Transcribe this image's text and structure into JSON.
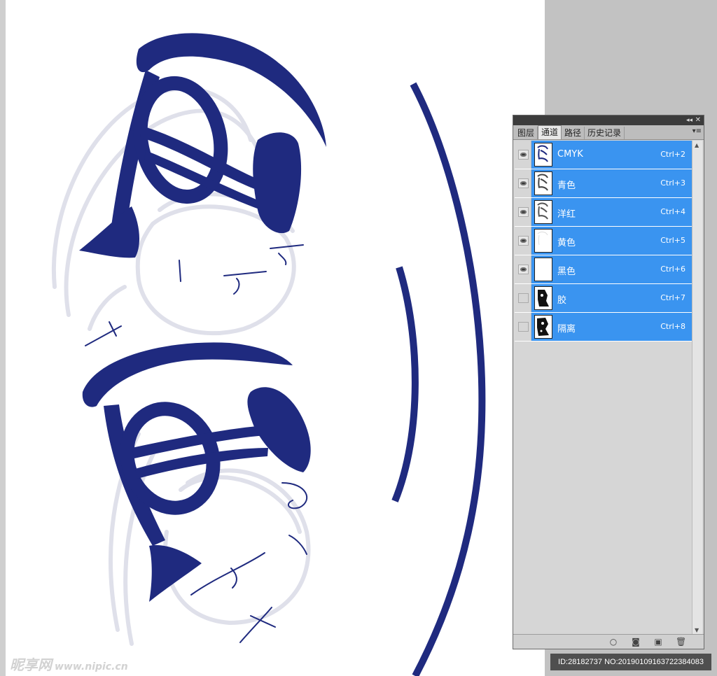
{
  "panel": {
    "tabs": [
      {
        "label": "图层"
      },
      {
        "label": "通道"
      },
      {
        "label": "路径"
      },
      {
        "label": "历史记录"
      }
    ],
    "active_tab": "通道",
    "collapse_glyph": "◂◂",
    "close_glyph": "✕",
    "menu_glyph": "▾≡",
    "channels": [
      {
        "name": "CMYK",
        "shortcut": "Ctrl+2",
        "visible": true,
        "selected": true
      },
      {
        "name": "青色",
        "shortcut": "Ctrl+3",
        "visible": true,
        "selected": true
      },
      {
        "name": "洋红",
        "shortcut": "Ctrl+4",
        "visible": true,
        "selected": true
      },
      {
        "name": "黄色",
        "shortcut": "Ctrl+5",
        "visible": true,
        "selected": true
      },
      {
        "name": "黑色",
        "shortcut": "Ctrl+6",
        "visible": true,
        "selected": true
      },
      {
        "name": "胶",
        "shortcut": "Ctrl+7",
        "visible": false,
        "selected": true
      },
      {
        "name": "隔离",
        "shortcut": "Ctrl+8",
        "visible": false,
        "selected": true
      }
    ],
    "footer_icons": [
      "load-selection-icon",
      "save-selection-icon",
      "new-channel-icon",
      "delete-channel-icon"
    ]
  },
  "colors": {
    "ink": "#1f2a7f",
    "sketch": "#d9dae6",
    "selection": "#3a94f0"
  },
  "watermark": {
    "logo_text": "昵享网",
    "url": "www.nipic.cn",
    "id_text": "ID:28182737 NO:20190109163722384083"
  }
}
